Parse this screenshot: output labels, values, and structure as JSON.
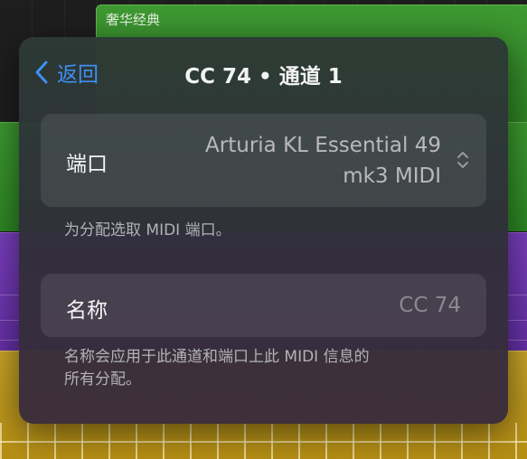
{
  "background": {
    "region_title": "奢华经典"
  },
  "popover": {
    "back_label": "返回",
    "title": "CC 74 • 通道 1",
    "port": {
      "label": "端口",
      "value_line1": "Arturia KL Essential 49",
      "value_line2": "mk3 MIDI",
      "hint": "为分配选取 MIDI 端口。"
    },
    "name": {
      "label": "名称",
      "value": "",
      "placeholder": "CC 74",
      "hint_line1": "名称会应用于此通道和端口上此 MIDI 信息的",
      "hint_line2": "所有分配。"
    }
  },
  "colors": {
    "accent": "#3e8ff5",
    "track_green": "#3e9a30",
    "track_purple": "#7a3fbf",
    "track_yellow": "#c9a528"
  }
}
